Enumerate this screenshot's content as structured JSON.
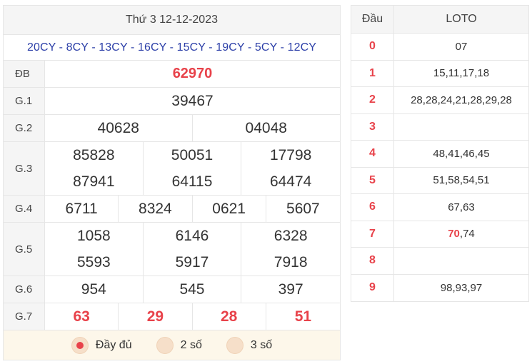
{
  "results": {
    "date_title": "Thứ 3 12-12-2023",
    "codes": "20CY - 8CY - 13CY - 16CY - 15CY - 19CY - 5CY - 12CY",
    "prizes": {
      "db": {
        "label": "ĐB",
        "values": [
          "62970"
        ]
      },
      "g1": {
        "label": "G.1",
        "values": [
          "39467"
        ]
      },
      "g2": {
        "label": "G.2",
        "values": [
          "40628",
          "04048"
        ]
      },
      "g3": {
        "label": "G.3",
        "values": [
          "85828",
          "50051",
          "17798",
          "87941",
          "64115",
          "64474"
        ]
      },
      "g4": {
        "label": "G.4",
        "values": [
          "6711",
          "8324",
          "0621",
          "5607"
        ]
      },
      "g5": {
        "label": "G.5",
        "values": [
          "1058",
          "6146",
          "6328",
          "5593",
          "5917",
          "7918"
        ]
      },
      "g6": {
        "label": "G.6",
        "values": [
          "954",
          "545",
          "397"
        ]
      },
      "g7": {
        "label": "G.7",
        "values": [
          "63",
          "29",
          "28",
          "51"
        ]
      }
    },
    "controls": {
      "full": "Đầy đủ",
      "two": "2 số",
      "three": "3 số",
      "selected": "full"
    }
  },
  "loto": {
    "header_dau": "Đầu",
    "header_loto": "LOTO",
    "rows": [
      {
        "head": "0",
        "pre": "",
        "hl": "",
        "post": "07"
      },
      {
        "head": "1",
        "pre": "",
        "hl": "",
        "post": "15,11,17,18"
      },
      {
        "head": "2",
        "pre": "",
        "hl": "",
        "post": "28,28,24,21,28,29,28"
      },
      {
        "head": "3",
        "pre": "",
        "hl": "",
        "post": ""
      },
      {
        "head": "4",
        "pre": "",
        "hl": "",
        "post": "48,41,46,45"
      },
      {
        "head": "5",
        "pre": "",
        "hl": "",
        "post": "51,58,54,51"
      },
      {
        "head": "6",
        "pre": "",
        "hl": "",
        "post": "67,63"
      },
      {
        "head": "7",
        "pre": "",
        "hl": "70",
        "post": ",74"
      },
      {
        "head": "8",
        "pre": "",
        "hl": "",
        "post": ""
      },
      {
        "head": "9",
        "pre": "",
        "hl": "",
        "post": "98,93,97"
      }
    ]
  },
  "colors": {
    "accent_red": "#e8424a",
    "code_blue": "#2c3fa8",
    "control_bg": "#fdf7ea"
  }
}
